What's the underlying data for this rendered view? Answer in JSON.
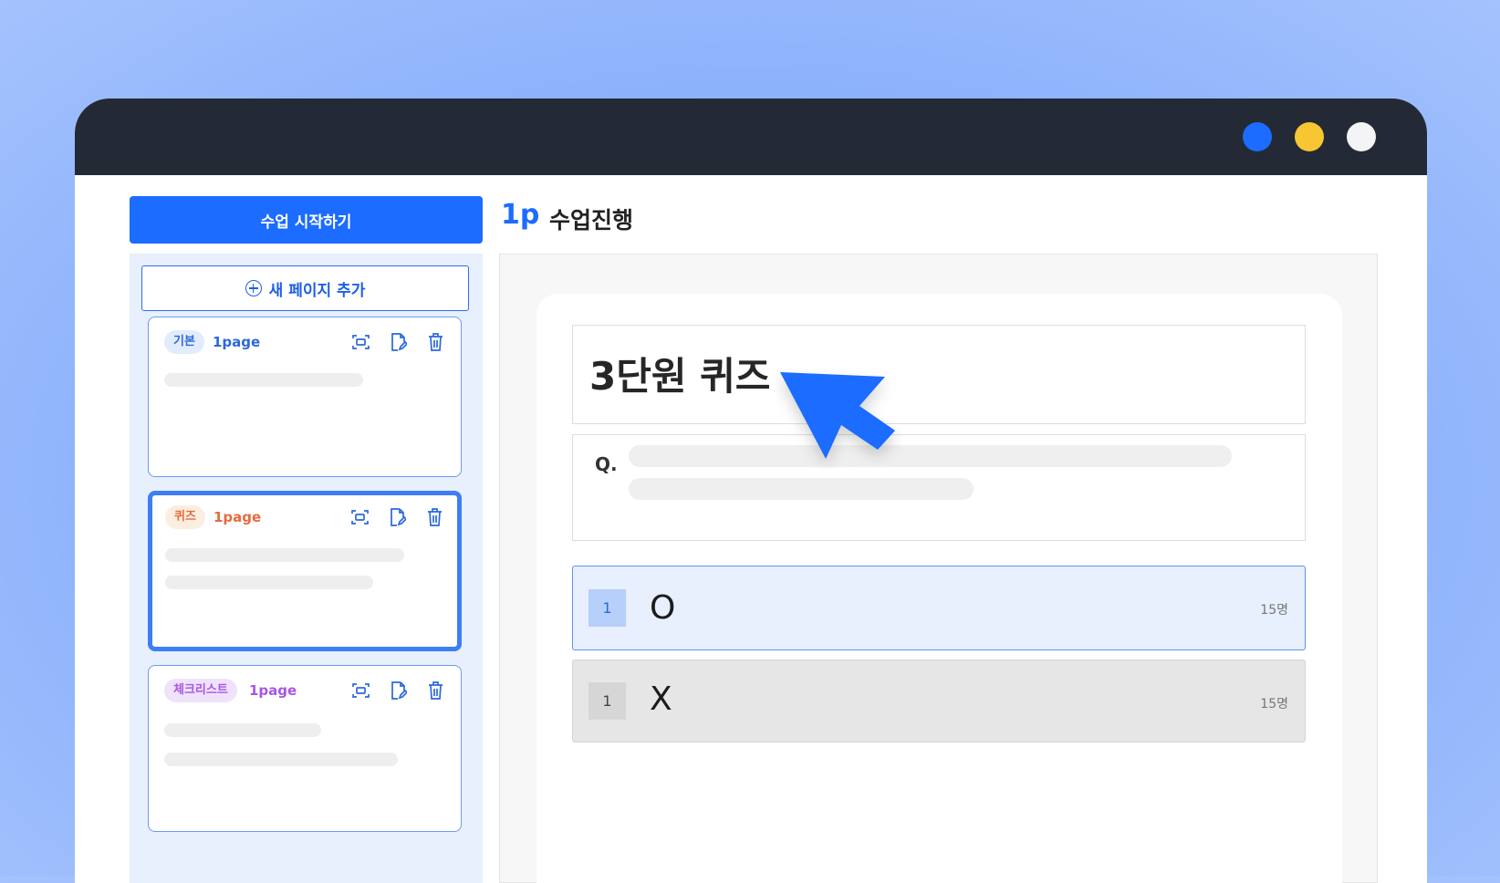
{
  "window": {
    "controls": [
      {
        "name": "blue-dot",
        "color": "#1b6cff"
      },
      {
        "name": "yellow-dot",
        "color": "#f8c632"
      },
      {
        "name": "white-dot",
        "color": "#f4f4f6"
      }
    ]
  },
  "sidebar": {
    "start_button": "수업 시작하기",
    "add_page": "새 페이지 추가",
    "cards": [
      {
        "tag": "기본",
        "page": "1page",
        "kind": "basic"
      },
      {
        "tag": "퀴즈",
        "page": "1page",
        "kind": "quiz",
        "selected": true
      },
      {
        "tag": "체크리스트",
        "page": "1page",
        "kind": "check"
      }
    ],
    "card_icons": [
      "capture-icon",
      "edit-page-icon",
      "trash-icon"
    ]
  },
  "header": {
    "page_number": "1p",
    "title": "수업진행"
  },
  "quiz": {
    "title": "3단원 퀴즈",
    "question_label": "Q.",
    "answers": [
      {
        "number": "1",
        "text": "O",
        "count": "15명"
      },
      {
        "number": "1",
        "text": "X",
        "count": "15명"
      }
    ]
  },
  "colors": {
    "accent": "#1b6cff",
    "titlebar": "#232a35"
  }
}
